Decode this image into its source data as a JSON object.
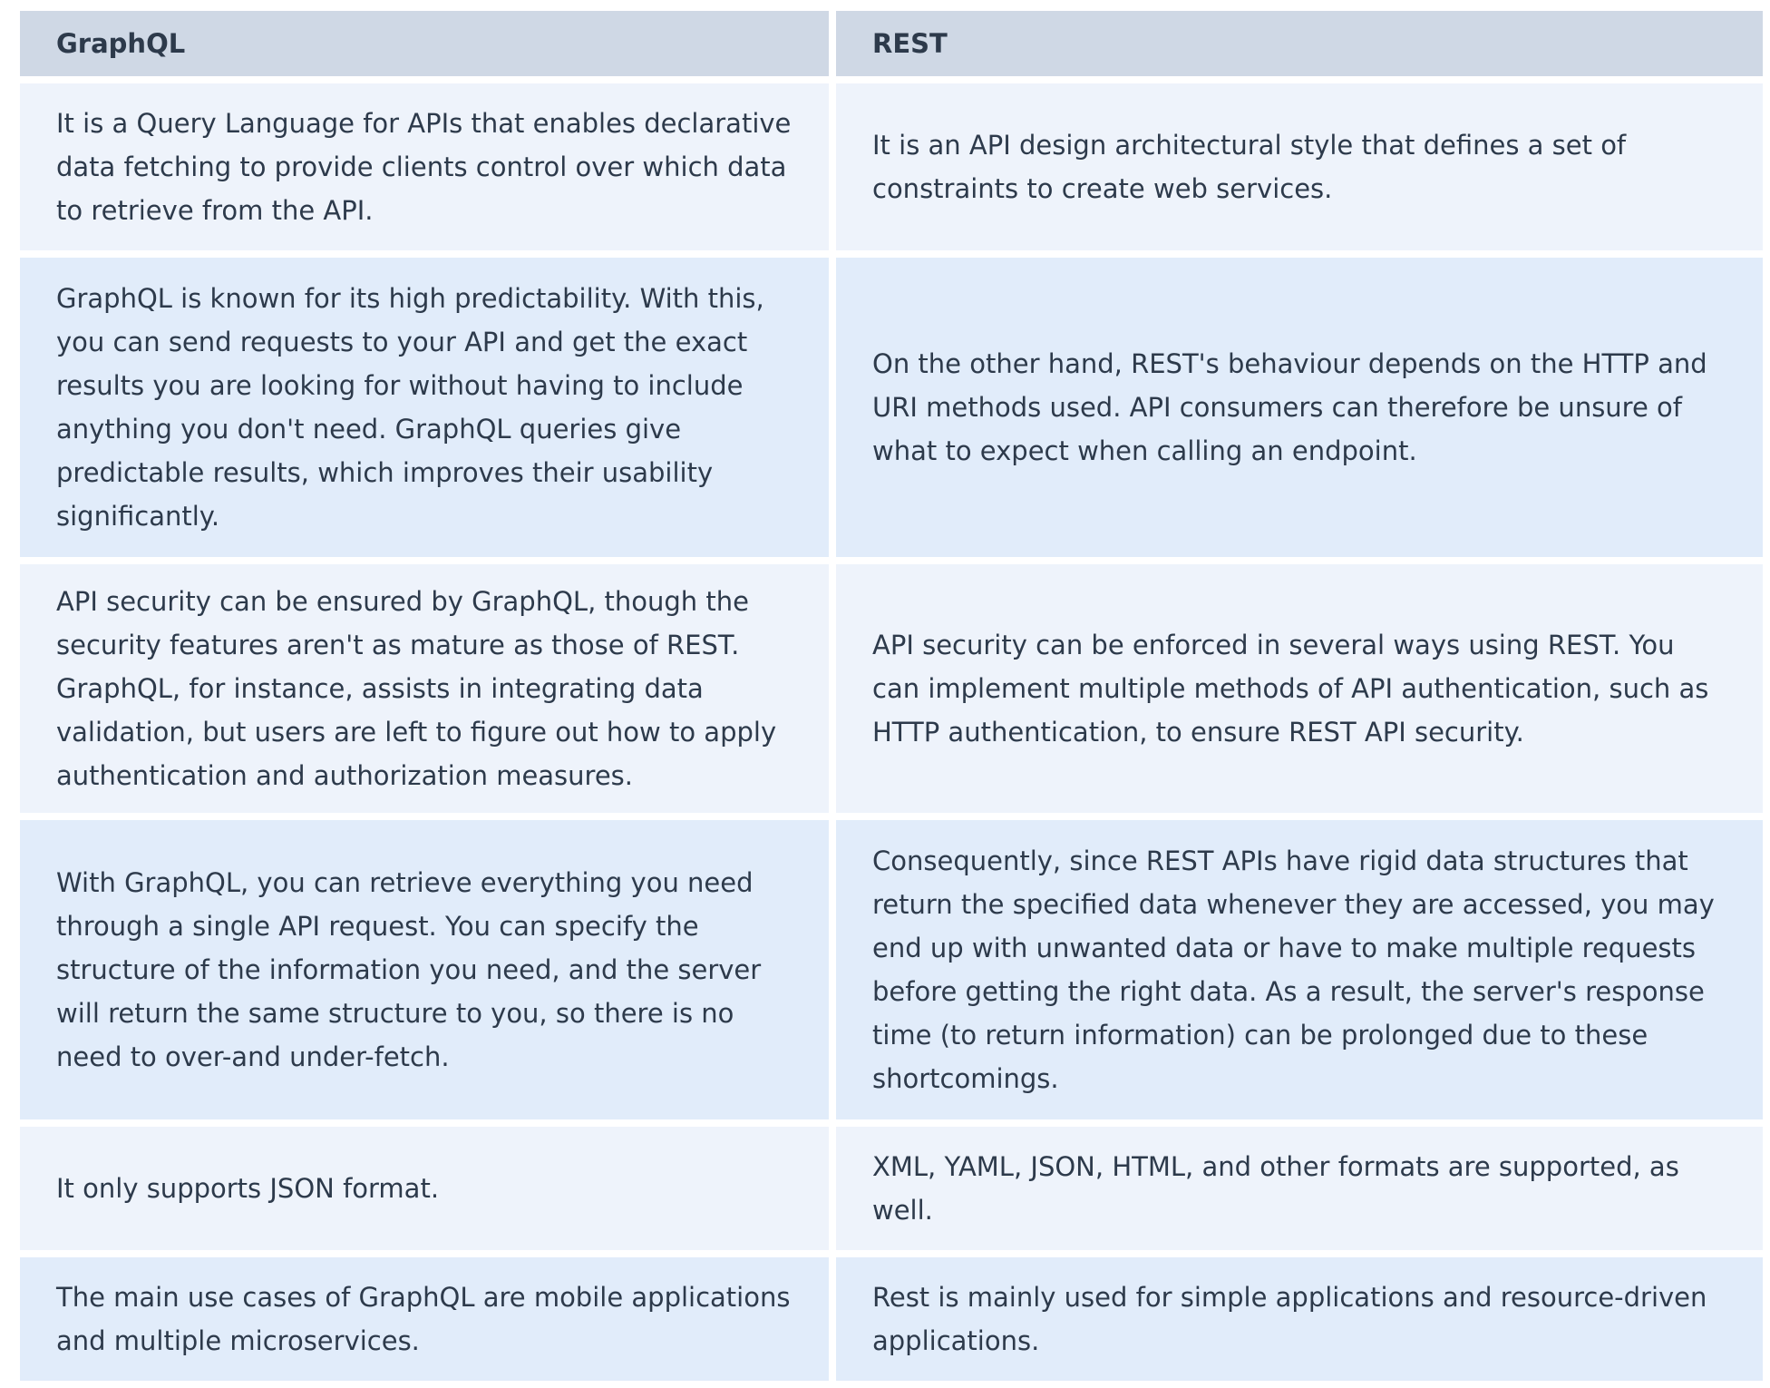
{
  "table": {
    "headers": [
      "GraphQL",
      "REST"
    ],
    "rows": [
      {
        "graphql": "It is a Query Language for APIs that enables declarative data fetching to provide clients control over which data to retrieve from the API.",
        "rest": "It is an API design architectural style that defines a set of constraints to create web services."
      },
      {
        "graphql": "GraphQL is known for its high predictability. With this, you can send requests to your API and get the exact results you are looking for without having to include anything you don't need. GraphQL queries give predictable results, which improves their usability significantly.",
        "rest": "On the other hand, REST's behaviour depends on the HTTP and URI methods used. API consumers can therefore be unsure of what to expect when calling an endpoint."
      },
      {
        "graphql": "API security can be ensured by GraphQL, though the security features aren't as mature as those of REST. GraphQL, for instance, assists in integrating data validation, but users are left to figure out how to apply authentication and authorization measures.",
        "rest": "API security can be enforced in several ways using REST. You can implement multiple methods of API authentication, such as HTTP authentication, to ensure REST API security."
      },
      {
        "graphql": "With GraphQL, you can retrieve everything you need through a single API request. You can specify the structure of the information you need, and the server will return the same structure to you, so there is no need to over-and under-fetch.",
        "rest": "Consequently, since REST APIs have rigid data structures that return the specified data whenever they are accessed, you may end up with unwanted data or have to make multiple requests before getting the right data. As a result, the server's response time (to return information) can be prolonged due to these shortcomings."
      },
      {
        "graphql": "It only supports JSON format.",
        "rest": "XML, YAML, JSON, HTML, and other formats are supported, as well."
      },
      {
        "graphql": "The main use cases of GraphQL are mobile applications and multiple microservices.",
        "rest": "Rest is mainly used for simple applications and resource-driven applications."
      }
    ]
  },
  "colors": {
    "header_bg": "#cfd8e5",
    "row_odd_bg": "#eef3fb",
    "row_even_bg": "#e1ecfa",
    "text": "#2d3a4b"
  }
}
